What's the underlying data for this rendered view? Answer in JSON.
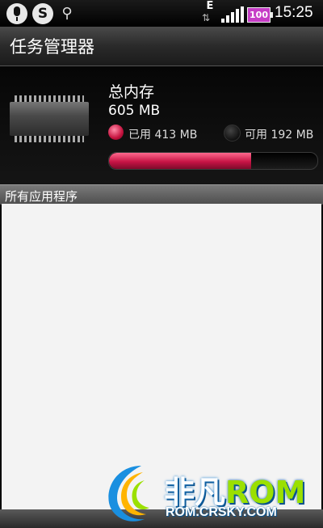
{
  "status_bar": {
    "network_type": "E",
    "network_arrows": "⇅",
    "battery": "100",
    "time": "15:25",
    "icons": [
      "microphone-icon",
      "s-app-icon",
      "usb-icon",
      "signal-icon",
      "battery-icon"
    ]
  },
  "app": {
    "title": "任务管理器"
  },
  "memory": {
    "heading": "总内存",
    "total": "605 MB",
    "used_label": "已用 413 MB",
    "free_label": "可用 192 MB",
    "used_mb": 413,
    "total_mb": 605,
    "used_fraction": 0.683,
    "used_color": "#c81445"
  },
  "list": {
    "header": "所有应用程序",
    "items": []
  },
  "watermark": {
    "brand_cn": "非凡",
    "brand_en": "ROM",
    "url": "ROM.CRSKY.COM"
  }
}
